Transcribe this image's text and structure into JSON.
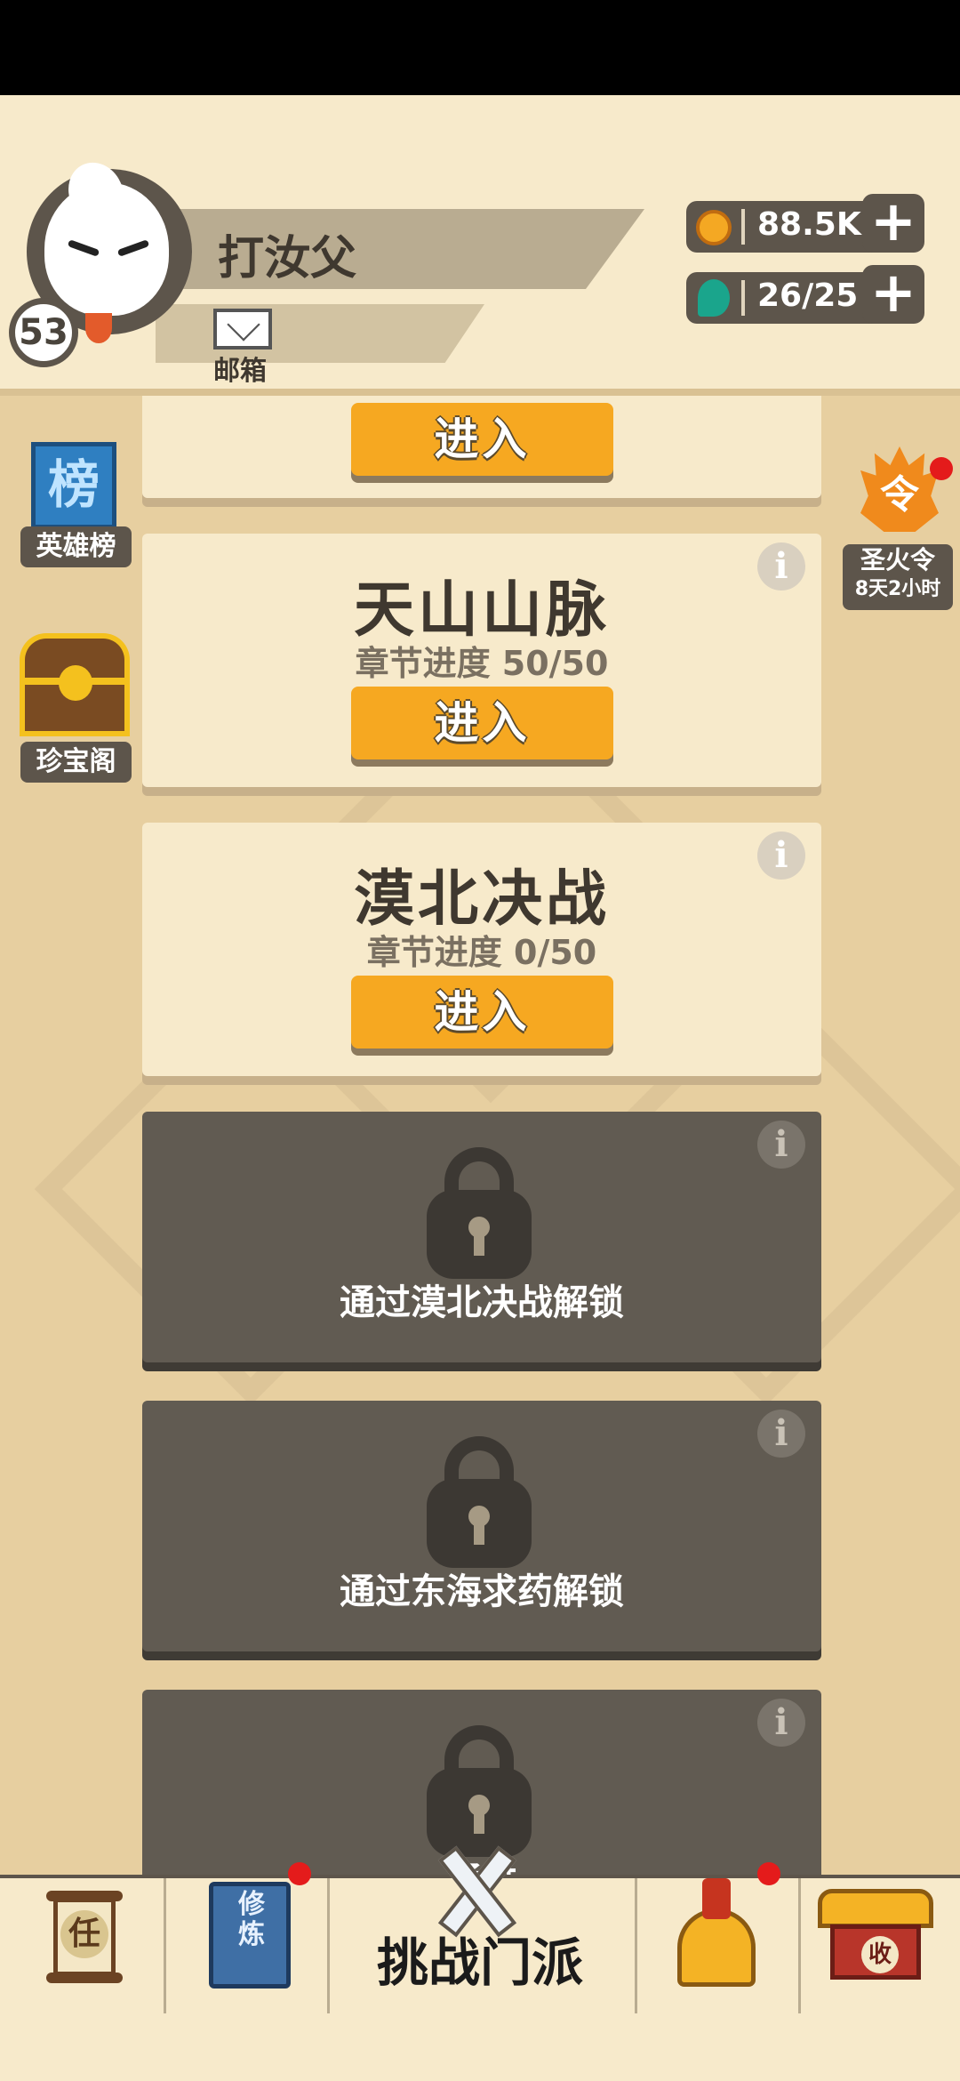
{
  "player": {
    "name": "打汝父",
    "level": "53",
    "mail_label": "邮箱"
  },
  "resources": {
    "coins": {
      "value": "88.5K",
      "icon": "coin-icon",
      "color": "#f4a823"
    },
    "gems": {
      "value": "26/25",
      "icon": "gem-icon",
      "color": "#1aa58c"
    },
    "plus_symbol": "+"
  },
  "side_left": [
    {
      "label": "英雄榜",
      "icon": "leaderboard-banner-icon",
      "glyph": "榜"
    },
    {
      "label": "珍宝阁",
      "icon": "treasure-chest-icon"
    }
  ],
  "side_right": {
    "glyph": "令",
    "label": "圣火令",
    "timer": "8天2小时",
    "icon": "sacred-fire-icon",
    "has_notification": true
  },
  "stages": [
    {
      "title": "",
      "progress": "",
      "button": "进入",
      "state": "unlocked-partial"
    },
    {
      "title": "天山山脉",
      "progress": "章节进度 50/50",
      "button": "进入",
      "state": "unlocked"
    },
    {
      "title": "漠北决战",
      "progress": "章节进度 0/50",
      "button": "进入",
      "state": "unlocked"
    },
    {
      "unlock_text": "通过漠北决战解锁",
      "state": "locked"
    },
    {
      "unlock_text": "通过东海求药解锁",
      "state": "locked"
    },
    {
      "unlock_text": "通过",
      "state": "locked-partial"
    }
  ],
  "info_symbol": "i",
  "bottom_nav": [
    {
      "name": "task",
      "icon": "task-scroll-icon",
      "glyph": "任"
    },
    {
      "name": "cultivate",
      "icon": "cultivation-book-icon",
      "glyph": "修炼",
      "has_notification": true
    },
    {
      "name": "challenge",
      "label": "挑战门派",
      "icon": "crossed-swords-icon",
      "active": true
    },
    {
      "name": "equipment",
      "icon": "helmet-icon",
      "has_notification": true
    },
    {
      "name": "collect",
      "icon": "shop-icon",
      "glyph": "收"
    }
  ],
  "colors": {
    "accent": "#f6a821",
    "panel": "#f7eacb",
    "dark": "#5d554b",
    "background": "#e7cfa0",
    "locked_card": "#615b52"
  }
}
